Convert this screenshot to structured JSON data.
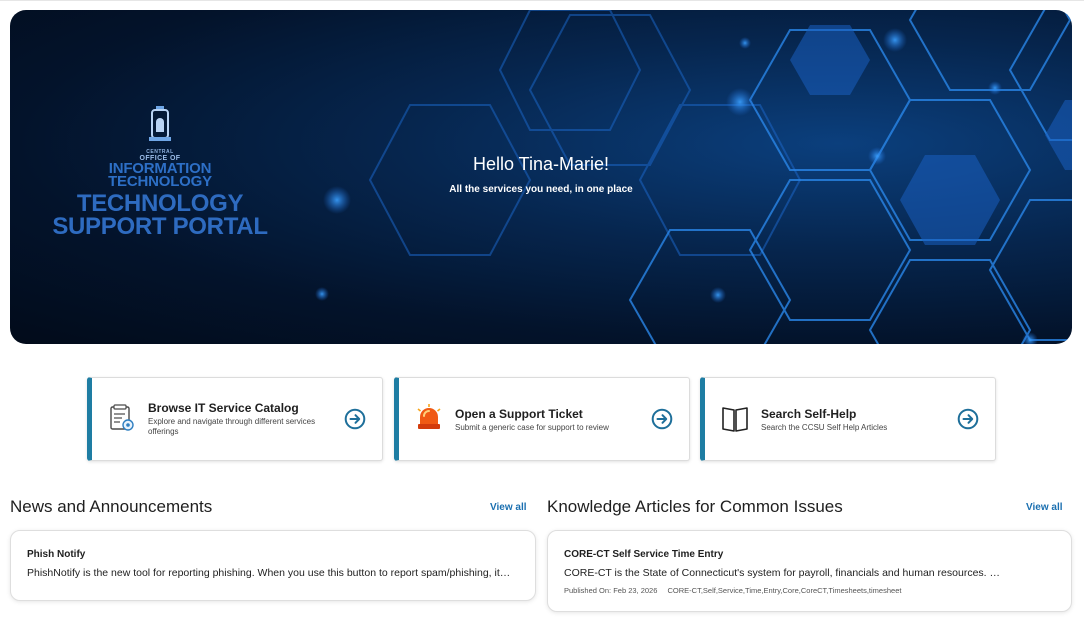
{
  "hero": {
    "greeting": "Hello Tina-Marie!",
    "subtitle": "All the services you need, in one place",
    "brand": {
      "seal_label": "CENTRAL",
      "office_line": "OFFICE OF",
      "info_line1": "INFORMATION",
      "info_line2": "TECHNOLOGY",
      "portal_line1": "TECHNOLOGY",
      "portal_line2": "SUPPORT PORTAL"
    }
  },
  "cards": [
    {
      "title": "Browse IT Service Catalog",
      "description": "Explore and navigate through different services offerings",
      "icon": "catalog-icon"
    },
    {
      "title": "Open a Support Ticket",
      "description": "Submit a generic case for support to review",
      "icon": "alarm-light-icon"
    },
    {
      "title": "Search Self-Help",
      "description": "Search the CCSU Self Help Articles",
      "icon": "book-icon"
    }
  ],
  "news": {
    "title": "News and Announcements",
    "view_all": "View all",
    "items": [
      {
        "title": "Phish Notify",
        "body": "PhishNotify is the new tool for reporting phishing. When you use this button to report spam/phishing, it…"
      }
    ]
  },
  "knowledge": {
    "title": "Knowledge Articles for Common Issues",
    "view_all": "View all",
    "items": [
      {
        "title": "CORE-CT Self Service Time Entry",
        "body": "CORE-CT is the State of Connecticut's system for payroll, financials and human resources. …",
        "published": "Published On: Feb 23, 2026",
        "tags": "CORE-CT,Self,Service,Time,Entry,Core,CoreCT,Timesheets,timesheet"
      }
    ]
  },
  "colors": {
    "accent": "#1e7da3",
    "link": "#1a6fb0",
    "hero_dark": "#03132b",
    "brand_blue": "#2e6bc0"
  }
}
